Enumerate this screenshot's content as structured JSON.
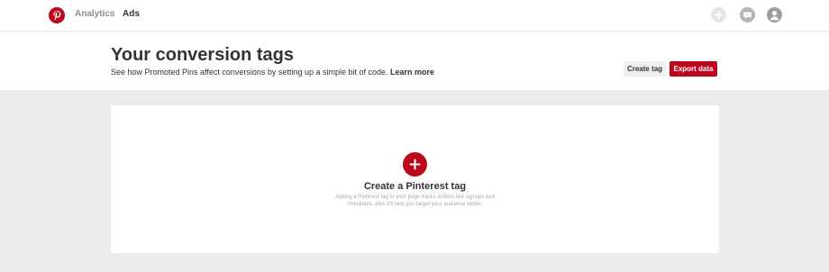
{
  "nav": {
    "links": [
      {
        "label": "Analytics"
      },
      {
        "label": "Ads"
      }
    ],
    "icons": [
      "pinterest-logo",
      "add-icon",
      "chat-icon",
      "profile-icon"
    ]
  },
  "header": {
    "title": "Your conversion tags",
    "subtitle": "See how Promoted Pins affect conversions by setting up a simple bit of code.",
    "learn_more": "Learn more",
    "create_tag_label": "Create tag",
    "export_data_label": "Export data"
  },
  "empty_state": {
    "title": "Create a Pinterest tag",
    "description": "Adding a Pinterest tag to your page tracks actions like signups and checkouts, plus it'll help you target your audience better."
  },
  "colors": {
    "brand": "#bd081c",
    "background": "#ececec"
  }
}
